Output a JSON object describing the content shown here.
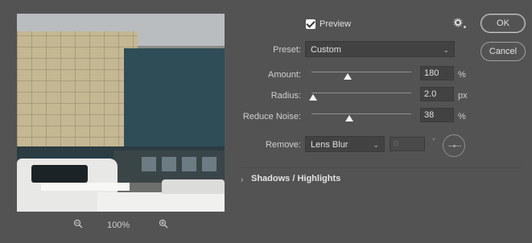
{
  "preview": {
    "label": "Preview",
    "checked": true
  },
  "zoom": {
    "zoom_out_icon": "zoom-out-icon",
    "value": "100%",
    "zoom_in_icon": "zoom-in-icon"
  },
  "buttons": {
    "ok": "OK",
    "cancel": "Cancel"
  },
  "settings": {
    "icon": "gear-icon"
  },
  "preset": {
    "label": "Preset:",
    "value": "Custom"
  },
  "amount": {
    "label": "Amount:",
    "value": "180",
    "unit": "%",
    "level": 0.36
  },
  "radius": {
    "label": "Radius:",
    "value": "2.0",
    "unit": "px",
    "level": 0.02
  },
  "reduce_noise": {
    "label": "Reduce Noise:",
    "value": "38",
    "unit": "%",
    "level": 0.38
  },
  "remove": {
    "label": "Remove:",
    "value": "Lens Blur",
    "angle_value": "0",
    "degree_symbol": "°"
  },
  "section": {
    "title": "Shadows / Highlights",
    "caret": "›"
  }
}
